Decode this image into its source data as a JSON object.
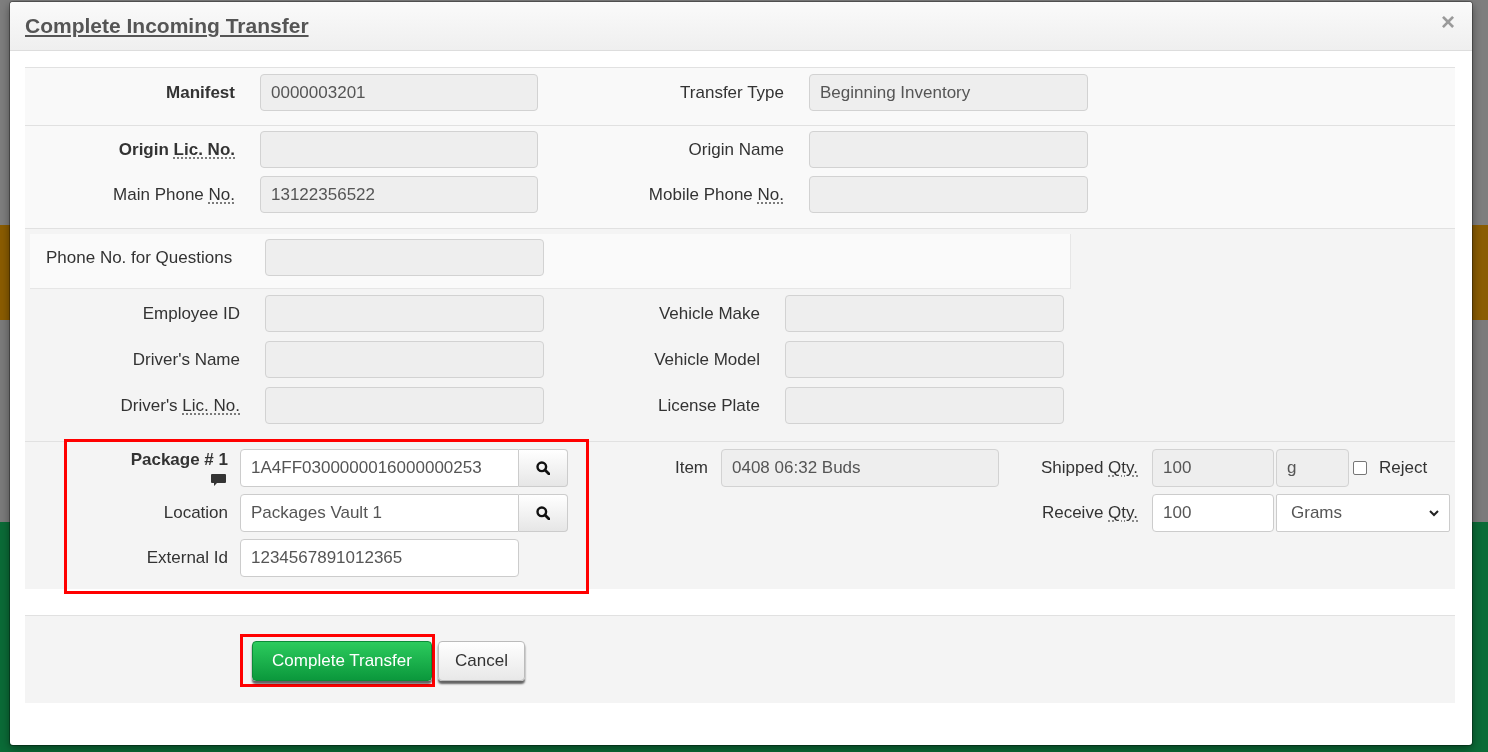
{
  "dialog": {
    "title": "Complete Incoming Transfer",
    "close": "×"
  },
  "manifest": [
    {
      "label": "Manifest",
      "bold": true,
      "value": "0000003201",
      "disabled": true
    },
    {
      "label": "Transfer Type",
      "bold": false,
      "value": "Beginning Inventory",
      "disabled": true
    }
  ],
  "origin": [
    [
      {
        "label_parts": [
          {
            "text": "Origin ",
            "abbr": false
          },
          {
            "text": "Lic. No.",
            "abbr": true
          }
        ],
        "bold": true,
        "disabled": true
      },
      {
        "label": "Origin Name",
        "bold": false,
        "disabled": true
      }
    ],
    [
      {
        "label_parts": [
          {
            "text": "Main Phone ",
            "abbr": false
          },
          {
            "text": "No.",
            "abbr": true
          }
        ],
        "bold": false,
        "value": "13122356522",
        "disabled": true
      },
      {
        "label_parts": [
          {
            "text": "Mobile Phone ",
            "abbr": false
          },
          {
            "text": "No.",
            "abbr": true
          }
        ],
        "bold": false,
        "disabled": true
      }
    ]
  ],
  "driver": {
    "question": {
      "label": "Phone No. for Questions",
      "bold": false,
      "disabled": true
    },
    "rows": [
      [
        {
          "label": "Employee ID",
          "bold": false,
          "disabled": true
        },
        {
          "label": "Vehicle Make",
          "bold": false,
          "disabled": true
        }
      ],
      [
        {
          "label": "Driver's Name",
          "bold": false,
          "disabled": true
        },
        {
          "label": "Vehicle Model",
          "bold": false,
          "disabled": true
        }
      ],
      [
        {
          "label_parts": [
            {
              "text": "Driver's ",
              "abbr": false
            },
            {
              "text": "Lic. No.",
              "abbr": true
            }
          ],
          "bold": false,
          "disabled": true
        },
        {
          "label": "License Plate",
          "bold": false,
          "disabled": true
        }
      ]
    ]
  },
  "package": {
    "highlighted": true,
    "fields": [
      {
        "kind": "lookup",
        "label": "Package # 1",
        "bold": true,
        "note": true,
        "value": "1A4FF0300000016000000253",
        "disabled": false
      },
      {
        "kind": "lookup",
        "label": "Location",
        "bold": false,
        "note": false,
        "value": "Packages Vault 1",
        "disabled": false
      },
      {
        "kind": "text",
        "label": "External Id",
        "bold": false,
        "note": false,
        "value": "1234567891012365",
        "disabled": false
      }
    ],
    "item": {
      "label": "Item",
      "bold": false,
      "value": "0408 06:32 Buds",
      "disabled": true
    },
    "shipped": {
      "label_parts": [
        {
          "text": "Shipped ",
          "abbr": false
        },
        {
          "text": "Qty.",
          "abbr": true
        }
      ],
      "bold": false,
      "value": "100",
      "disabled": true,
      "unit": {
        "kind": "text",
        "value": "g",
        "disabled": true
      }
    },
    "reject": {
      "label": "Reject",
      "checked": false
    },
    "receive": {
      "label_parts": [
        {
          "text": "Receive ",
          "abbr": false
        },
        {
          "text": "Qty.",
          "abbr": true
        }
      ],
      "bold": false,
      "value": "100",
      "disabled": false,
      "unit": {
        "kind": "select",
        "value": "Grams",
        "disabled": false
      }
    }
  },
  "actions": [
    {
      "label": "Complete Transfer",
      "kind": "submit",
      "highlighted": true
    },
    {
      "label": "Cancel",
      "kind": "cancel",
      "highlighted": false
    }
  ]
}
